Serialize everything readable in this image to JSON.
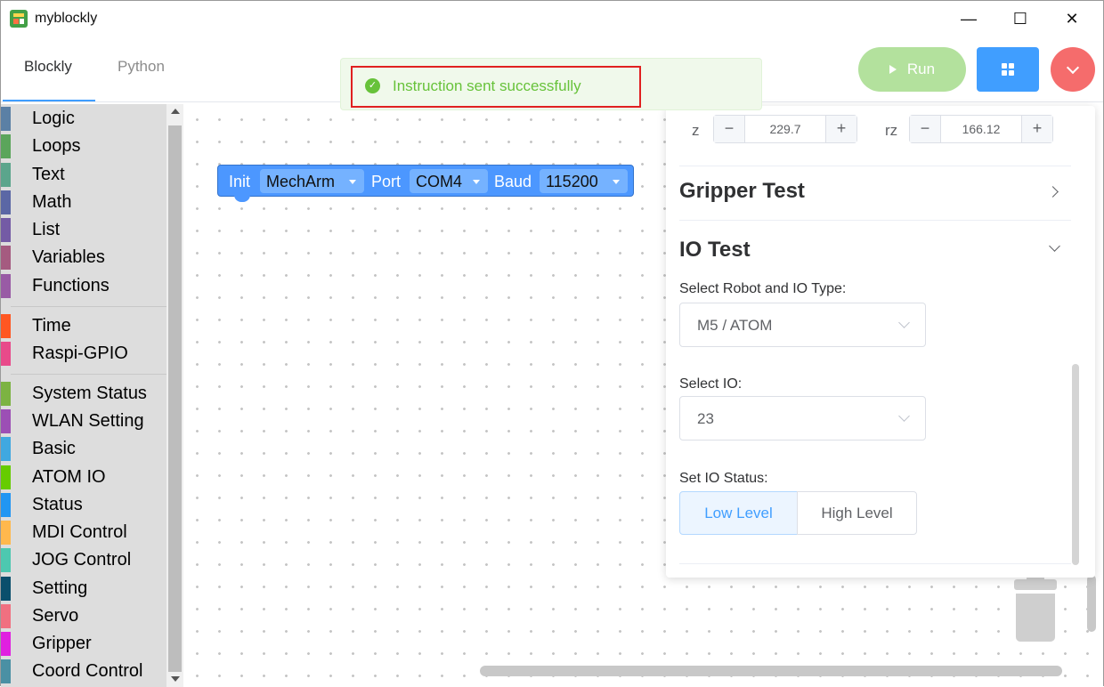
{
  "window": {
    "title": "myblockly",
    "minimize": "—",
    "maximize": "☐",
    "close": "✕"
  },
  "tabs": [
    {
      "label": "Blockly",
      "active": true
    },
    {
      "label": "Python",
      "active": false
    }
  ],
  "toast": {
    "message": "Instruction sent successfully",
    "check": "✓",
    "color": "#67c23a"
  },
  "actions": {
    "run_label": "Run",
    "grid_icon": "grid-icon",
    "menu_icon": "chevron-down-icon"
  },
  "toolbox": {
    "groups": [
      [
        {
          "label": "Logic",
          "color": "#5b80a5"
        },
        {
          "label": "Loops",
          "color": "#5ba55b"
        },
        {
          "label": "Text",
          "color": "#5ba58c"
        },
        {
          "label": "Math",
          "color": "#5b67a5"
        },
        {
          "label": "List",
          "color": "#745ba5"
        },
        {
          "label": "Variables",
          "color": "#a55b80"
        },
        {
          "label": "Functions",
          "color": "#995ba5"
        }
      ],
      [
        {
          "label": "Time",
          "color": "#ff5722"
        },
        {
          "label": "Raspi-GPIO",
          "color": "#e84a8a"
        }
      ],
      [
        {
          "label": "System Status",
          "color": "#7cb342"
        },
        {
          "label": "WLAN Setting",
          "color": "#9c4fb5"
        },
        {
          "label": "Basic",
          "color": "#40a8e0"
        },
        {
          "label": "ATOM IO",
          "color": "#66cc00"
        },
        {
          "label": "Status",
          "color": "#2196f3"
        },
        {
          "label": "MDI Control",
          "color": "#ffb84d"
        },
        {
          "label": "JOG Control",
          "color": "#4dc8b0"
        },
        {
          "label": "Setting",
          "color": "#0b4f6c"
        },
        {
          "label": "Servo",
          "color": "#f07080"
        },
        {
          "label": "Gripper",
          "color": "#e020e0"
        },
        {
          "label": "Coord Control",
          "color": "#4a90a4"
        }
      ]
    ]
  },
  "block": {
    "init": "Init",
    "robot": "MechArm",
    "port_label": "Port",
    "port": "COM4",
    "baud_label": "Baud",
    "baud": "115200"
  },
  "panel": {
    "z_label": "z",
    "z_value": "229.7",
    "rz_label": "rz",
    "rz_value": "166.12",
    "minus": "−",
    "plus": "+",
    "gripper_title": "Gripper Test",
    "io_title": "IO Test",
    "robot_io_label": "Select Robot and IO Type:",
    "robot_io_value": "M5 / ATOM",
    "io_label": "Select IO:",
    "io_value": "23",
    "status_label": "Set IO Status:",
    "low_level": "Low Level",
    "high_level": "High Level"
  }
}
